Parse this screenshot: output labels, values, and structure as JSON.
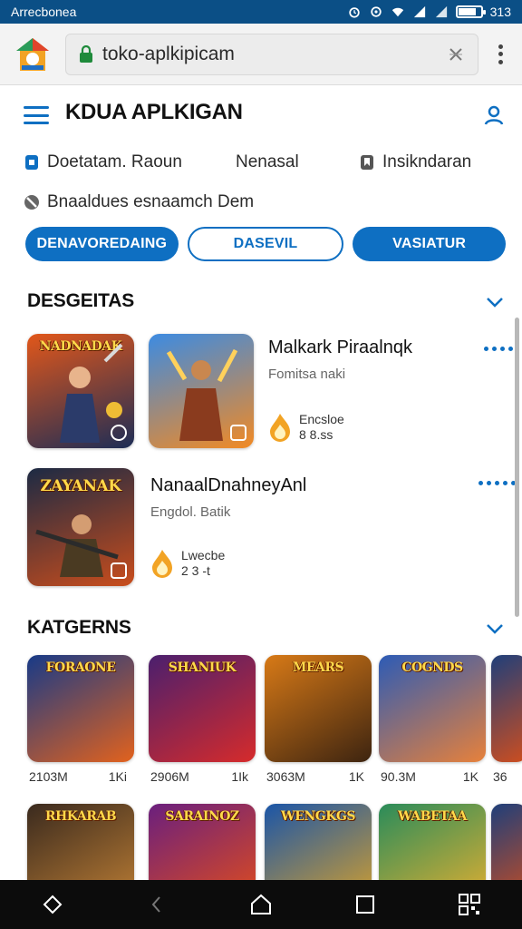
{
  "status_bar": {
    "carrier": "Arrecbonea",
    "clock": "313",
    "battery_level": 0.8
  },
  "browser": {
    "url": "toko-aplkipicam"
  },
  "app": {
    "title": "KDUA APLKIGAN"
  },
  "info": {
    "item1": "Doetatam. Raoun",
    "item2": "Nenasal",
    "item3": "Insikndaran",
    "line2": "Bnaaldues esnaamch Dem"
  },
  "filters": [
    "DENAVOREDAING",
    "DASEVIL",
    "VASIATUR"
  ],
  "section_featured": {
    "title": "DESGEITAS"
  },
  "featured": [
    {
      "thumb_caption": "NADNADAK",
      "title": "Malkark Piraalnqk",
      "subtitle": "Fomitsa naki",
      "meta_label": "Encsloe",
      "meta_value": "8 8.ss",
      "colors": [
        "#e2571a",
        "#1d2d56"
      ]
    },
    {
      "thumb_caption": "",
      "title": "",
      "subtitle": "",
      "meta_label": "",
      "meta_value": "",
      "colors": [
        "#3c8be2",
        "#f28a23"
      ]
    },
    {
      "thumb_caption": "ZAYANAK",
      "title": "NanaalDnahneyAnl",
      "subtitle": "Engdol. Batik",
      "meta_label": "Lwecbe",
      "meta_value": "2 3 -t",
      "colors": [
        "#1c2a44",
        "#c94d1c"
      ]
    }
  ],
  "section_categories": {
    "title": "KATGERNS"
  },
  "categories_row1": [
    {
      "caption": "FORAONE",
      "size": "2103M",
      "count": "1Ki",
      "colors": [
        "#173a88",
        "#e2621d"
      ]
    },
    {
      "caption": "SHANIUK",
      "size": "2906M",
      "count": "1Ik",
      "colors": [
        "#4a1f6e",
        "#d62b2b"
      ]
    },
    {
      "caption": "MEARS",
      "size": "3063M",
      "count": "1K",
      "colors": [
        "#d87a17",
        "#3d2410"
      ]
    },
    {
      "caption": "COGNDS",
      "size": "90.3M",
      "count": "1K",
      "colors": [
        "#2c5bb6",
        "#e7813b"
      ]
    },
    {
      "caption": "",
      "size": "36",
      "count": "",
      "colors": [
        "#1f3f7a",
        "#ce4e1f"
      ]
    }
  ],
  "categories_row2": [
    {
      "caption": "RHKARAB",
      "colors": [
        "#3a2a1e",
        "#c08035"
      ]
    },
    {
      "caption": "SARAINOZ",
      "colors": [
        "#6a1f7e",
        "#e34e1a"
      ]
    },
    {
      "caption": "WENGKGS",
      "colors": [
        "#1a55a8",
        "#d9a22a"
      ]
    },
    {
      "caption": "WABETAA",
      "colors": [
        "#2a8c5a",
        "#e8b030"
      ]
    },
    {
      "caption": "",
      "colors": [
        "#1f3f7a",
        "#ce4e1f"
      ]
    }
  ]
}
